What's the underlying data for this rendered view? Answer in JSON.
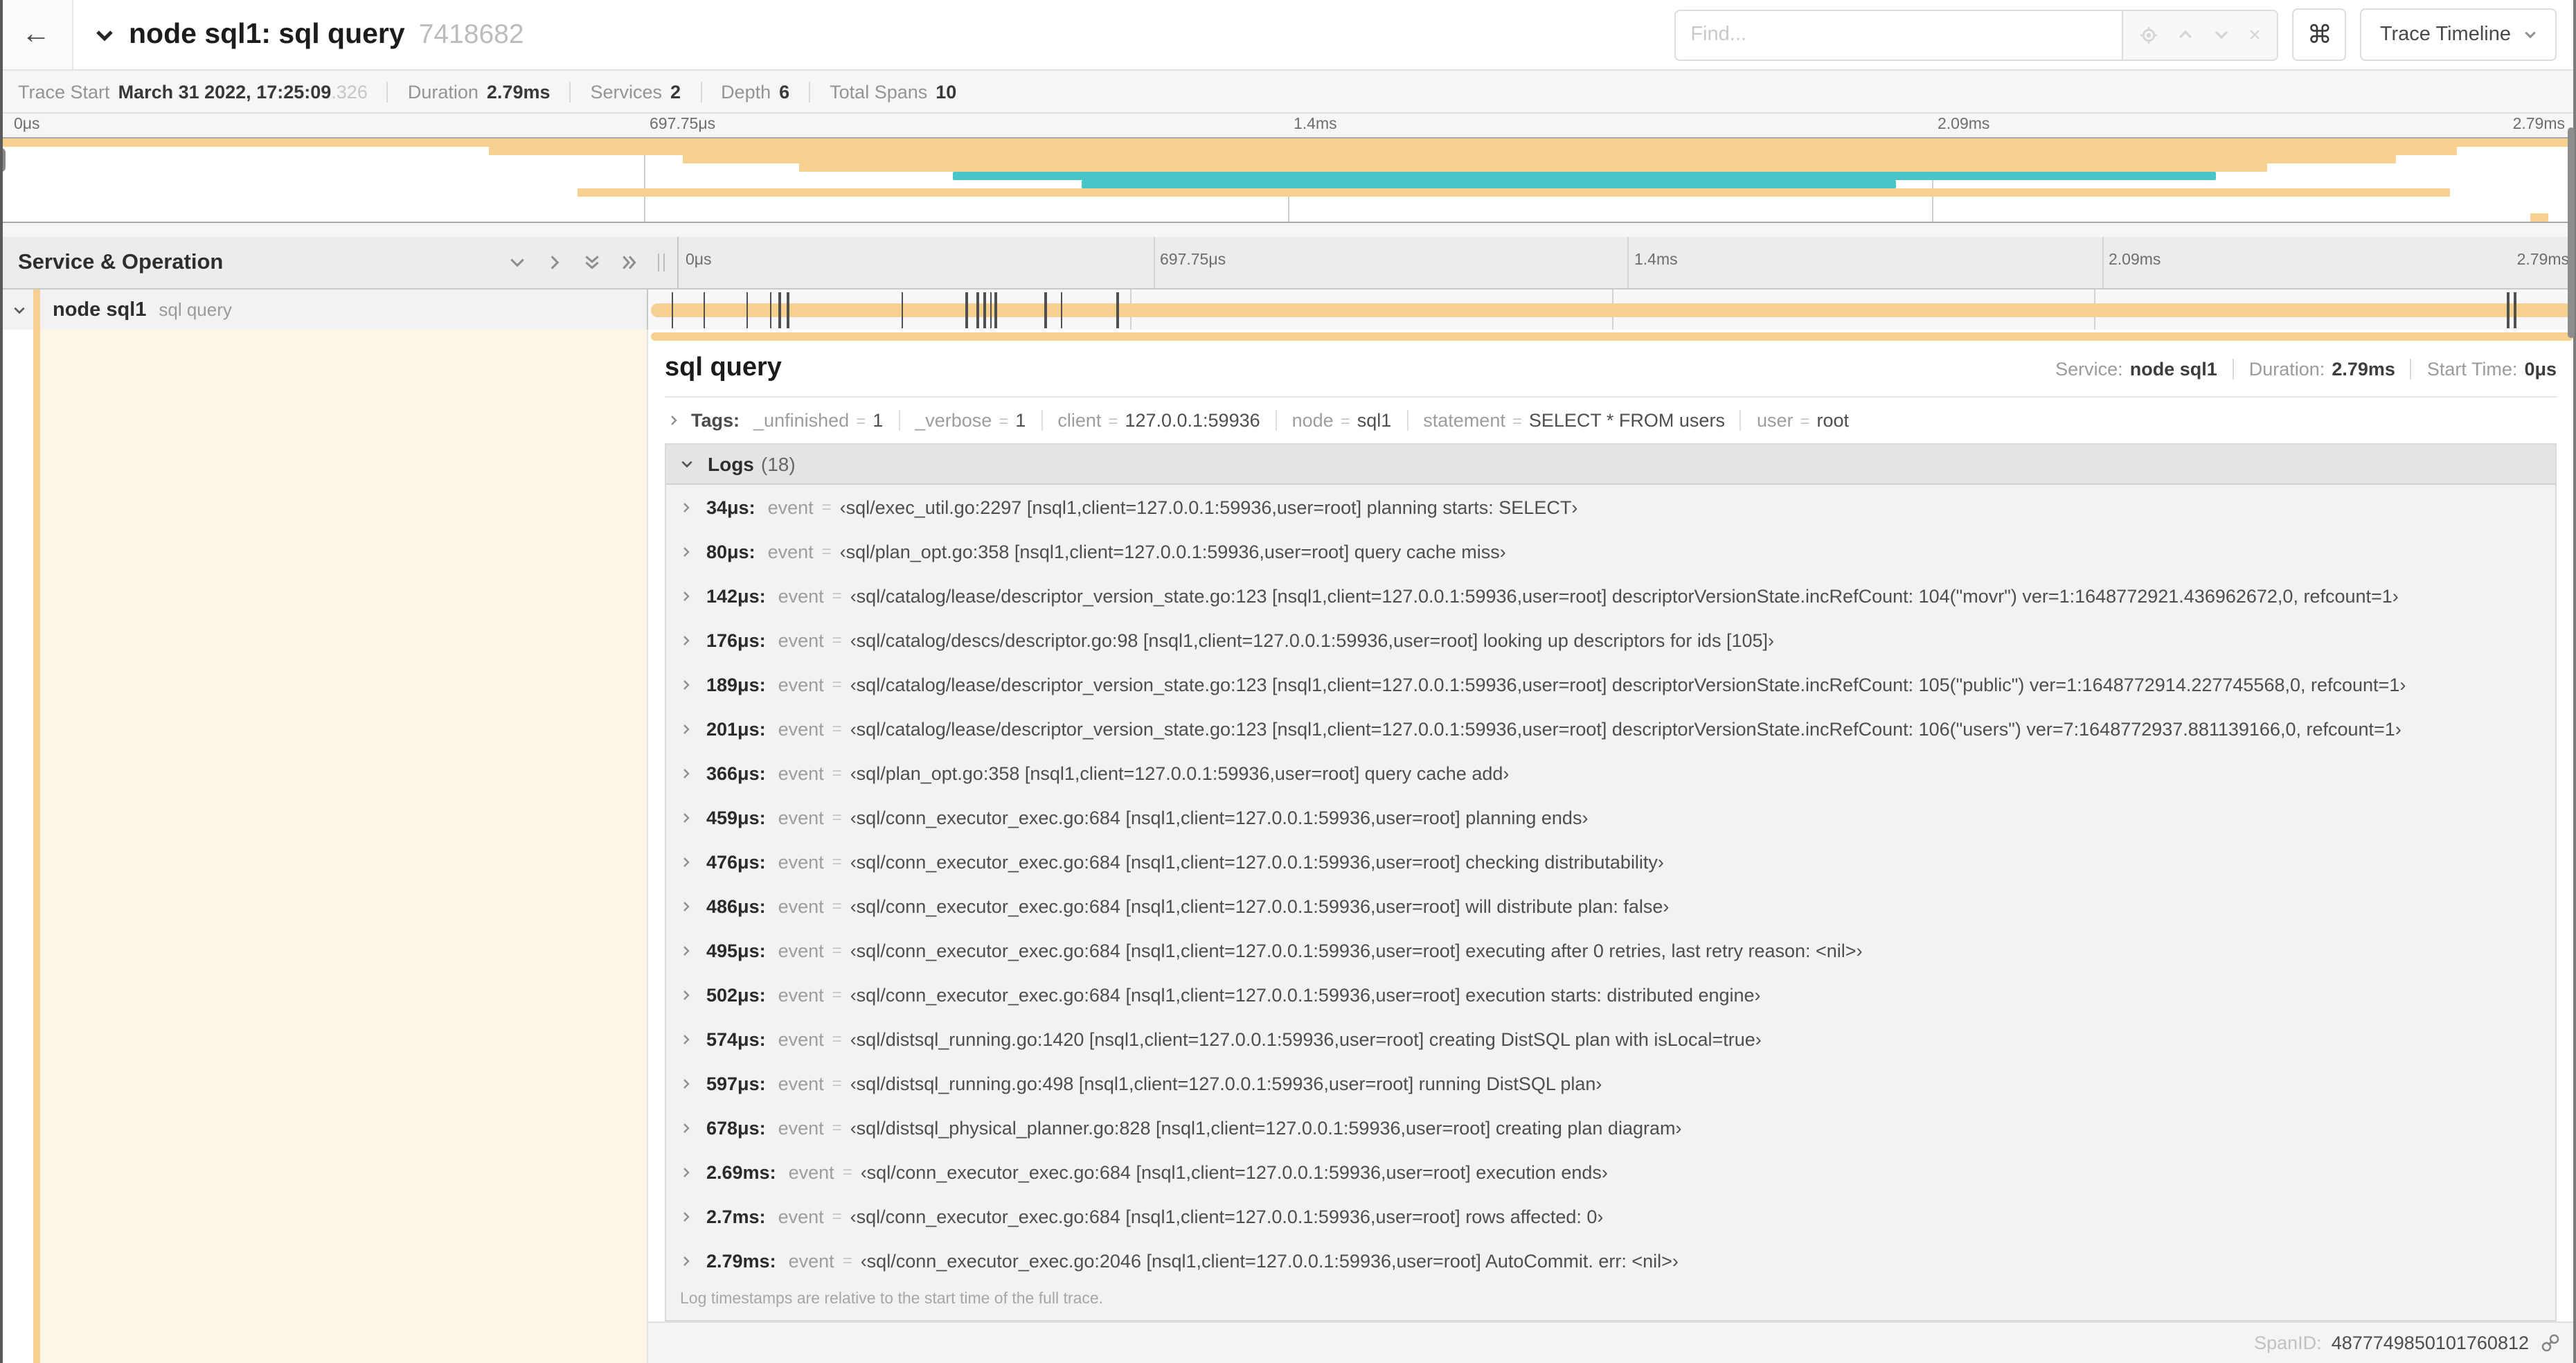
{
  "header": {
    "title": "node sql1: sql query",
    "trace_id": "7418682",
    "find_placeholder": "Find...",
    "shortcut_key": "⌘",
    "view_selector": "Trace Timeline"
  },
  "stats": [
    {
      "label": "Trace Start",
      "value": "March 31 2022, 17:25:09",
      "suffix": ".326"
    },
    {
      "label": "Duration",
      "value": "2.79ms",
      "suffix": ""
    },
    {
      "label": "Services",
      "value": "2",
      "suffix": ""
    },
    {
      "label": "Depth",
      "value": "6",
      "suffix": ""
    },
    {
      "label": "Total Spans",
      "value": "10",
      "suffix": ""
    }
  ],
  "colors": {
    "tan": "#F5D08F",
    "teal": "#48C5C7",
    "cream": "rgba(245,208,143,0.22)"
  },
  "minimap": {
    "axis_labels": [
      "0μs",
      "697.75μs",
      "1.4ms",
      "2.09ms",
      "2.79ms"
    ],
    "rows": [
      {
        "start": 0.0,
        "end": 1.0,
        "color": "tan"
      },
      {
        "start": 0.19,
        "end": 0.954,
        "color": "tan"
      },
      {
        "start": 0.265,
        "end": 0.93,
        "color": "tan"
      },
      {
        "start": 0.31,
        "end": 0.88,
        "color": "tan"
      },
      {
        "start": 0.37,
        "end": 0.86,
        "color": "teal"
      },
      {
        "start": 0.42,
        "end": 0.736,
        "color": "teal"
      },
      {
        "start": 0.224,
        "end": 0.951,
        "color": "tan"
      },
      {
        "start": 0,
        "end": 0,
        "color": null
      },
      {
        "start": 0,
        "end": 0,
        "color": null
      },
      {
        "start": 0.982,
        "end": 0.989,
        "color": "tan"
      }
    ]
  },
  "timeline": {
    "left_header_title": "Service & Operation",
    "axis_labels": [
      "0μs",
      "697.75μs",
      "1.4ms",
      "2.09ms",
      "2.79ms"
    ],
    "row": {
      "service": "node sql1",
      "operation": "sql query"
    },
    "duration_us": 2790,
    "tick_times_us": [
      34,
      80,
      142,
      176,
      189,
      201,
      366,
      459,
      476,
      486,
      495,
      502,
      574,
      597,
      678,
      2690,
      2700,
      2786
    ]
  },
  "detail": {
    "operation": "sql query",
    "overview": [
      {
        "label": "Service:",
        "value": "node sql1"
      },
      {
        "label": "Duration:",
        "value": "2.79ms"
      },
      {
        "label": "Start Time:",
        "value": "0μs"
      }
    ],
    "tags_label": "Tags:",
    "eq": "=",
    "tags": [
      {
        "key": "_unfinished",
        "value": "1"
      },
      {
        "key": "_verbose",
        "value": "1"
      },
      {
        "key": "client",
        "value": "127.0.0.1:59936"
      },
      {
        "key": "node",
        "value": "sql1"
      },
      {
        "key": "statement",
        "value": "SELECT * FROM users"
      },
      {
        "key": "user",
        "value": "root"
      }
    ],
    "logs_title": "Logs",
    "logs_count": "(18)",
    "logs_key": "event",
    "logs": [
      {
        "ts": "34μs:",
        "value": "‹sql/exec_util.go:2297 [nsql1,client=127.0.0.1:59936,user=root] planning starts: SELECT›"
      },
      {
        "ts": "80μs:",
        "value": "‹sql/plan_opt.go:358 [nsql1,client=127.0.0.1:59936,user=root] query cache miss›"
      },
      {
        "ts": "142μs:",
        "value": "‹sql/catalog/lease/descriptor_version_state.go:123 [nsql1,client=127.0.0.1:59936,user=root] descriptorVersionState.incRefCount: 104(\"movr\") ver=1:1648772921.436962672,0, refcount=1›"
      },
      {
        "ts": "176μs:",
        "value": "‹sql/catalog/descs/descriptor.go:98 [nsql1,client=127.0.0.1:59936,user=root] looking up descriptors for ids [105]›"
      },
      {
        "ts": "189μs:",
        "value": "‹sql/catalog/lease/descriptor_version_state.go:123 [nsql1,client=127.0.0.1:59936,user=root] descriptorVersionState.incRefCount: 105(\"public\") ver=1:1648772914.227745568,0, refcount=1›"
      },
      {
        "ts": "201μs:",
        "value": "‹sql/catalog/lease/descriptor_version_state.go:123 [nsql1,client=127.0.0.1:59936,user=root] descriptorVersionState.incRefCount: 106(\"users\") ver=7:1648772937.881139166,0, refcount=1›"
      },
      {
        "ts": "366μs:",
        "value": "‹sql/plan_opt.go:358 [nsql1,client=127.0.0.1:59936,user=root] query cache add›"
      },
      {
        "ts": "459μs:",
        "value": "‹sql/conn_executor_exec.go:684 [nsql1,client=127.0.0.1:59936,user=root] planning ends›"
      },
      {
        "ts": "476μs:",
        "value": "‹sql/conn_executor_exec.go:684 [nsql1,client=127.0.0.1:59936,user=root] checking distributability›"
      },
      {
        "ts": "486μs:",
        "value": "‹sql/conn_executor_exec.go:684 [nsql1,client=127.0.0.1:59936,user=root] will distribute plan: false›"
      },
      {
        "ts": "495μs:",
        "value": "‹sql/conn_executor_exec.go:684 [nsql1,client=127.0.0.1:59936,user=root] executing after 0 retries, last retry reason: <nil>›"
      },
      {
        "ts": "502μs:",
        "value": "‹sql/conn_executor_exec.go:684 [nsql1,client=127.0.0.1:59936,user=root] execution starts: distributed engine›"
      },
      {
        "ts": "574μs:",
        "value": "‹sql/distsql_running.go:1420 [nsql1,client=127.0.0.1:59936,user=root] creating DistSQL plan with isLocal=true›"
      },
      {
        "ts": "597μs:",
        "value": "‹sql/distsql_running.go:498 [nsql1,client=127.0.0.1:59936,user=root] running DistSQL plan›"
      },
      {
        "ts": "678μs:",
        "value": "‹sql/distsql_physical_planner.go:828 [nsql1,client=127.0.0.1:59936,user=root] creating plan diagram›"
      },
      {
        "ts": "2.69ms:",
        "value": "‹sql/conn_executor_exec.go:684 [nsql1,client=127.0.0.1:59936,user=root] execution ends›"
      },
      {
        "ts": "2.7ms:",
        "value": "‹sql/conn_executor_exec.go:684 [nsql1,client=127.0.0.1:59936,user=root] rows affected: 0›"
      },
      {
        "ts": "2.79ms:",
        "value": "‹sql/conn_executor_exec.go:2046 [nsql1,client=127.0.0.1:59936,user=root] AutoCommit. err: <nil>›"
      }
    ],
    "logs_footer": "Log timestamps are relative to the start time of the full trace.",
    "spanid_label": "SpanID:",
    "spanid": "4877749850101760812"
  }
}
